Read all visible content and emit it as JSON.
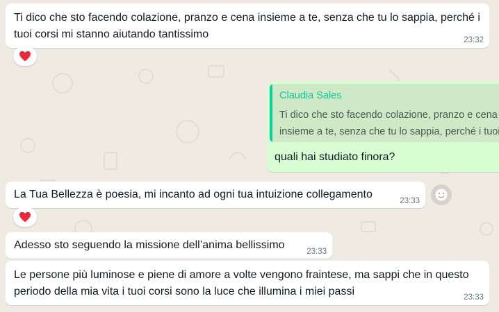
{
  "colors": {
    "background": "#efeae2",
    "incoming_bubble": "#ffffff",
    "outgoing_bubble": "#d9fdd3",
    "quote_accent": "#06cf9c",
    "reaction_heart": "#e8293c"
  },
  "messages": [
    {
      "direction": "incoming",
      "text": "Ti dico che sto facendo colazione, pranzo e cena insieme a te, senza che tu lo sappia, perché i tuoi corsi mi stanno aiutando tantissimo",
      "time": "23:32",
      "reaction": "heart-icon"
    },
    {
      "direction": "outgoing",
      "quote": {
        "author": "Claudia Sales",
        "text": "Ti dico che sto facendo colazione, pranzo e cena insieme a te, senza che tu lo sappia, perché i tuoi corsi mi stanno aiutando tantissimo"
      },
      "text": "quali hai studiato finora?"
    },
    {
      "direction": "incoming",
      "text": "La Tua Bellezza è poesia, mi incanto ad ogni tua intuizione collegamento",
      "time": "23:33",
      "reaction": "heart-icon",
      "reaction_button": "smiley-icon"
    },
    {
      "direction": "incoming",
      "text": "Adesso sto seguendo la missione dell’anima bellissimo",
      "time": "23:33"
    },
    {
      "direction": "incoming",
      "text": "Le persone più luminose e piene di amore a volte vengono fraintese, ma sappi che in questo periodo della mia vita i tuoi corsi sono la luce che illumina i miei passi",
      "time": "23:33"
    }
  ]
}
